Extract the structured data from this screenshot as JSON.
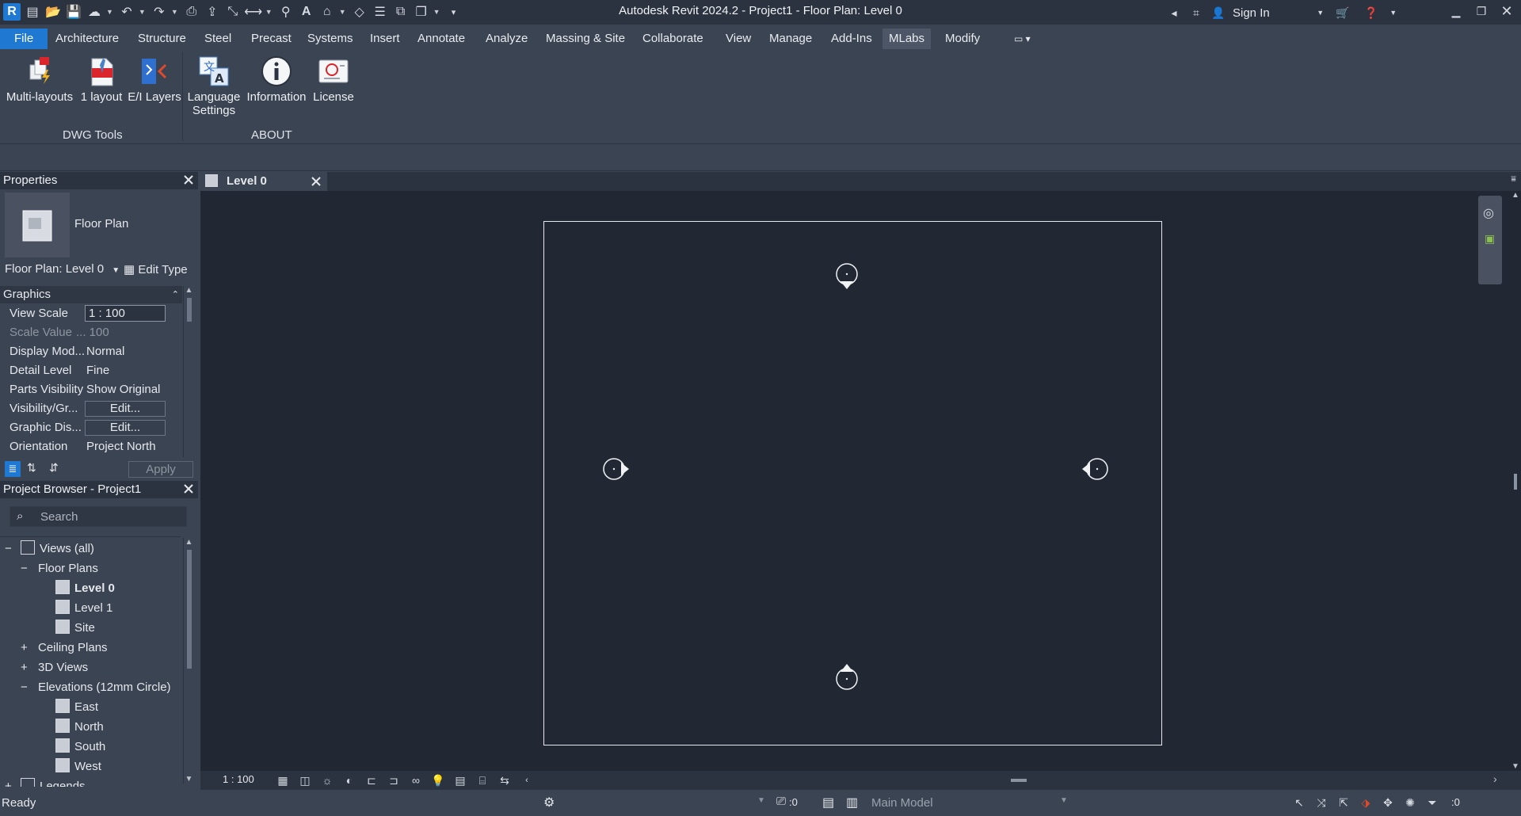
{
  "app": {
    "title": "Autodesk Revit 2024.2 - Project1 - Floor Plan: Level 0",
    "logo_letter": "R",
    "sign_in": "Sign In"
  },
  "menu": {
    "file": "File",
    "items": [
      "Architecture",
      "Structure",
      "Steel",
      "Precast",
      "Systems",
      "Insert",
      "Annotate",
      "Analyze",
      "Massing & Site",
      "Collaborate",
      "View",
      "Manage",
      "Add-Ins",
      "MLabs",
      "Modify"
    ],
    "active": "MLabs"
  },
  "ribbon": {
    "buttons": [
      {
        "label": "Multi-layouts",
        "icon": "multi-layouts-icon"
      },
      {
        "label": "1 layout",
        "icon": "pdf-layout-icon"
      },
      {
        "label": "E/I Layers",
        "icon": "ei-layers-icon"
      },
      {
        "label": "Language Settings",
        "line1": "Language",
        "line2": "Settings",
        "icon": "translate-icon"
      },
      {
        "label": "Information",
        "icon": "info-icon"
      },
      {
        "label": "License",
        "icon": "license-icon"
      }
    ],
    "panels": [
      "DWG Tools",
      "ABOUT"
    ]
  },
  "properties": {
    "title": "Properties",
    "type_name": "Floor Plan",
    "instance": "Floor Plan: Level 0",
    "edit_type": "Edit Type",
    "section": "Graphics",
    "rows": [
      {
        "key": "View Scale",
        "value": "1 : 100"
      },
      {
        "key": "Scale Value",
        "value": "... 100"
      },
      {
        "key": "Display Mod...",
        "value": "Normal"
      },
      {
        "key": "Detail Level",
        "value": "Fine"
      },
      {
        "key": "Parts Visibility",
        "value": "Show Original"
      },
      {
        "key": "Visibility/Gr...",
        "value": "Edit..."
      },
      {
        "key": "Graphic Dis...",
        "value": "Edit..."
      },
      {
        "key": "Orientation",
        "value": "Project North"
      }
    ],
    "apply": "Apply"
  },
  "browser": {
    "title": "Project Browser - Project1",
    "search_placeholder": "Search",
    "tree": {
      "root": "Views (all)",
      "floor_plans": "Floor Plans",
      "level0": "Level 0",
      "level1": "Level 1",
      "site": "Site",
      "ceiling_plans": "Ceiling Plans",
      "views3d": "3D Views",
      "elevations": "Elevations (12mm Circle)",
      "east": "East",
      "north": "North",
      "south": "South",
      "west": "West",
      "legends": "Legends"
    }
  },
  "view": {
    "tab_label": "Level 0",
    "scale": "1 : 100"
  },
  "status": {
    "ready": "Ready",
    "worksets_count": ":0",
    "model": "Main Model",
    "filter_count": ":0"
  }
}
